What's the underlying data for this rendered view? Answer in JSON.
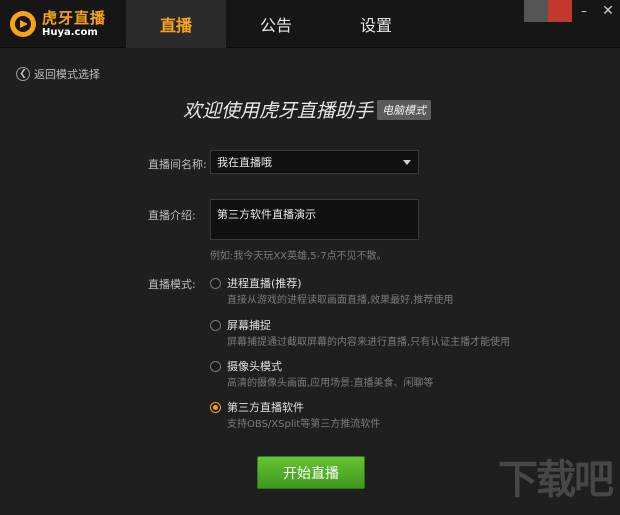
{
  "header": {
    "logo_cn": "虎牙直播",
    "logo_en": "Huya.com",
    "tabs": [
      {
        "label": "直播",
        "active": true
      },
      {
        "label": "公告",
        "active": false
      },
      {
        "label": "设置",
        "active": false
      }
    ],
    "window_controls": {
      "minimize": "–",
      "close": "✕"
    }
  },
  "nav": {
    "back_label": "返回模式选择",
    "back_icon": "chevron-left-icon"
  },
  "welcome": {
    "title": "欢迎使用虎牙直播助手",
    "badge": "电脑模式"
  },
  "form": {
    "room_name_label": "直播间名称:",
    "room_name_value": "我在直播哦",
    "intro_label": "直播介绍:",
    "intro_value": "第三方软件直播演示",
    "intro_hint": "例如:我今天玩XX英雄,5-7点不见不散。",
    "mode_label": "直播模式:",
    "modes": [
      {
        "title": "进程直播(推荐)",
        "desc": "直接从游戏的进程读取画面直播,效果最好,推荐使用",
        "checked": false
      },
      {
        "title": "屏幕捕捉",
        "desc": "屏幕捕提通过截取屏幕的内容来进行直播,只有认证主播才能使用",
        "checked": false
      },
      {
        "title": "摄像头模式",
        "desc": "高清的摄像头画面,应用场景:直播美食、闲聊等",
        "checked": false
      },
      {
        "title": "第三方直播软件",
        "desc": "支持OBS/XSplit等第三方推流软件",
        "checked": true
      }
    ],
    "start_button": "开始直播"
  },
  "watermark": "下载吧",
  "colors": {
    "accent": "#f6a21a",
    "start_button": "#4caf26",
    "background": "#1f1f1f",
    "topbar": "#161616"
  }
}
